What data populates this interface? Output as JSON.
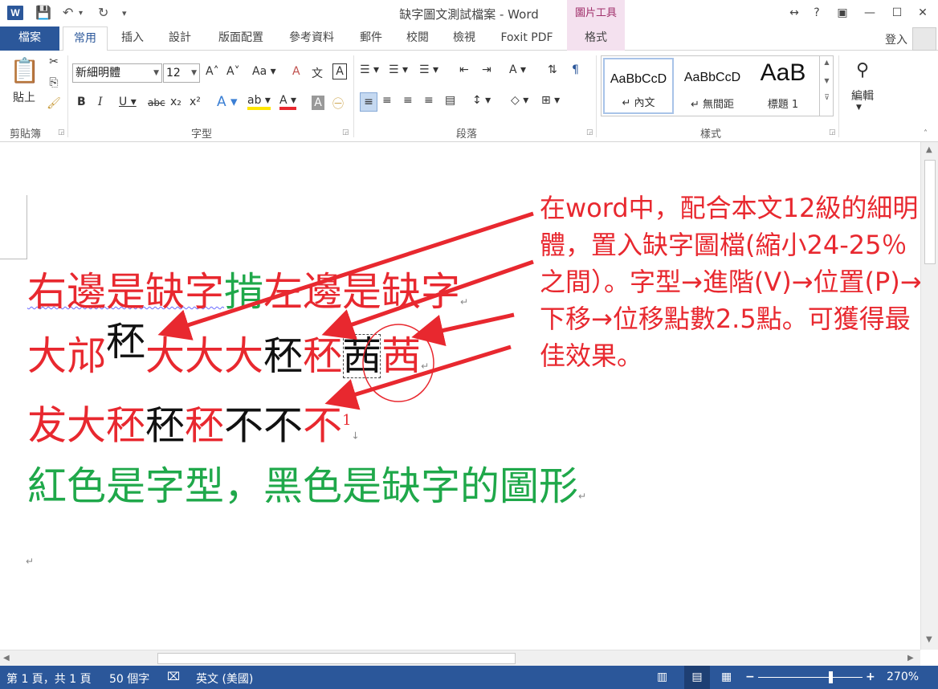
{
  "window": {
    "title": "缺字圖文測試檔案 - Word",
    "tool_context": "圖片工具",
    "controls": [
      "?",
      "↔"
    ]
  },
  "tabs": {
    "file": "檔案",
    "home": "常用",
    "insert": "插入",
    "design": "設計",
    "layout": "版面配置",
    "references": "參考資料",
    "mailings": "郵件",
    "review": "校閱",
    "view": "檢視",
    "foxit": "Foxit PDF",
    "format": "格式",
    "login": "登入"
  },
  "ribbon": {
    "clipboard": {
      "paste": "貼上",
      "label": "剪貼簿"
    },
    "font": {
      "name": "新細明體",
      "size": "12",
      "label": "字型",
      "case_btn": "Aa"
    },
    "paragraph": {
      "label": "段落"
    },
    "styles": {
      "label": "樣式",
      "items": [
        {
          "sample": "AaBbCcD",
          "name": "↵ 內文"
        },
        {
          "sample": "AaBbCcD",
          "name": "↵ 無間距"
        },
        {
          "sample": "AaB",
          "name": "標題 1"
        }
      ]
    },
    "editing": {
      "label": "編輯"
    }
  },
  "document": {
    "line1": {
      "a": "右邊是缺字",
      "b": "掯",
      "c": "左邊是缺字"
    },
    "line2": {
      "a": "大邟",
      "b": "秠",
      "c": "大大大",
      "d": "秠",
      "e": "秠",
      "f": "茜",
      "g": "茜"
    },
    "line3": {
      "a": "犮大秠",
      "b": "秠",
      "c": "秠",
      "d": "不不",
      "e": "不",
      "sup": "1"
    },
    "line4": {
      "a": "紅色是字型",
      "b": "，黑色是缺字的圖形"
    },
    "annotation": "在word中，配合本文12級的細明體，置入缺字圖檔(縮小24-25％之間）。字型→進階(V)→位置(P)→下移→位移點數2.5點。可獲得最佳效果。"
  },
  "status": {
    "page": "第 1 頁，共 1 頁",
    "words": "50 個字",
    "language": "英文 (美國)",
    "zoom": "270%",
    "zoom_level_percent": 270
  },
  "colors": {
    "accent": "#2b579a",
    "red": "#e8282f",
    "green": "#1fa84a",
    "tools_tab": "#f4e1ef"
  }
}
